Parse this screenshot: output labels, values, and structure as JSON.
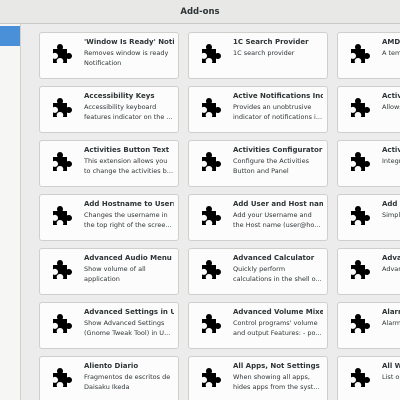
{
  "window": {
    "title": "Add-ons"
  },
  "extensions": [
    {
      "name": "'Window Is Ready' Notif...",
      "description": "Removes window is ready Notification",
      "icon": "puzzle-piece-icon"
    },
    {
      "name": "1C Search Provider",
      "description": "1C search provider",
      "icon": "puzzle-piece-icon"
    },
    {
      "name": "AMD-T",
      "description": "A temp GPU's,",
      "icon": "puzzle-piece-icon"
    },
    {
      "name": "Accessibility Keys",
      "description": "Accessibility keyboard features indicator on the ...",
      "icon": "puzzle-piece-icon"
    },
    {
      "name": "Active Notifications Ind...",
      "description": "Provides an unobtrusive indicator of notifications i...",
      "icon": "puzzle-piece-icon"
    },
    {
      "name": "Activit",
      "description": "Allows",
      "icon": "puzzle-piece-icon"
    },
    {
      "name": "Activities Button Text",
      "description": "This extension allows you to change the activities b...",
      "icon": "puzzle-piece-icon"
    },
    {
      "name": "Activities Configurator",
      "description": "Configure the Activities Button and Panel appeara...",
      "icon": "puzzle-piece-icon"
    },
    {
      "name": "Activit",
      "description": "Integra based a",
      "icon": "puzzle-piece-icon"
    },
    {
      "name": "Add Hostname to Userna...",
      "description": "Changes the username in the top right of the scree...",
      "icon": "puzzle-piece-icon"
    },
    {
      "name": "Add User and Host nam...",
      "description": "Add your Username and the Host name (user@ho...",
      "icon": "puzzle-piece-icon"
    },
    {
      "name": "Add Us",
      "description": "Simply to topb",
      "icon": "puzzle-piece-icon"
    },
    {
      "name": "Advanced Audio Menu",
      "description": "Show volume of all application",
      "icon": "puzzle-piece-icon"
    },
    {
      "name": "Advanced Calculator",
      "description": "Quickly perform calculations in the shell o...",
      "icon": "puzzle-piece-icon"
    },
    {
      "name": "Advan",
      "description": "Advanc (Gnom",
      "icon": "puzzle-piece-icon"
    },
    {
      "name": "Advanced Settings in Us...",
      "description": "Show Advanced Settings (Gnome Tweak Tool) in U...",
      "icon": "puzzle-piece-icon"
    },
    {
      "name": "Advanced Volume Mixer",
      "description": "Control programs' volume and output Features: - po...",
      "icon": "puzzle-piece-icon"
    },
    {
      "name": "Alarm C",
      "description": "Alarm c org.gn",
      "icon": "puzzle-piece-icon"
    },
    {
      "name": "Aliento Diario",
      "description": "Fragmentos de escritos de Daisaku Ikeda presentado...",
      "icon": "puzzle-piece-icon"
    },
    {
      "name": "All Apps, Not Settings",
      "description": "When showing all apps, hides apps from the syst...",
      "icon": "puzzle-piece-icon"
    },
    {
      "name": "All Win",
      "description": "List op workspa",
      "icon": "puzzle-piece-icon"
    }
  ]
}
